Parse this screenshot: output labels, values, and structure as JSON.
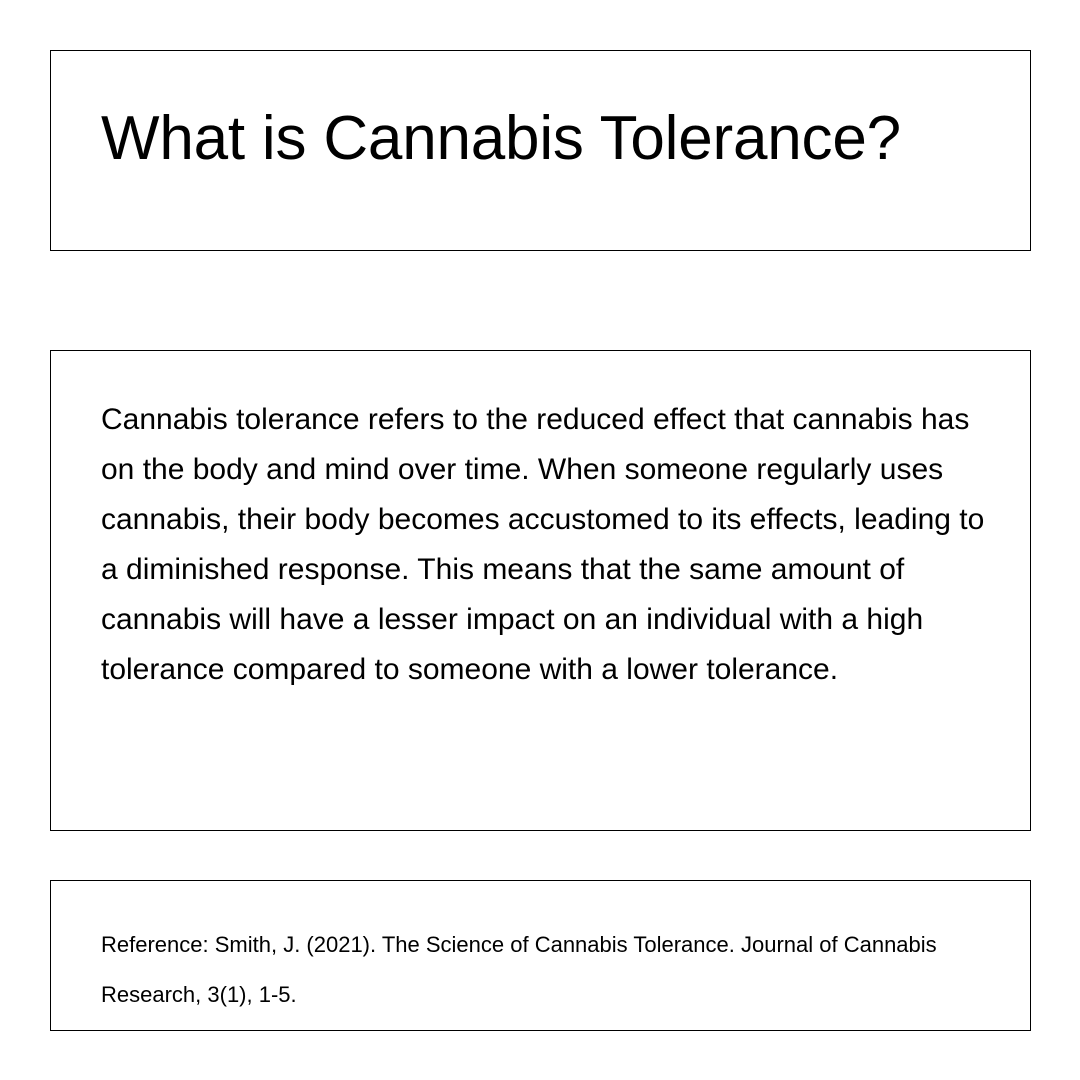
{
  "title": {
    "text": "What is Cannabis Tolerance?"
  },
  "body": {
    "text": "Cannabis tolerance refers to the reduced effect that cannabis has on the body and mind over time. When someone regularly uses cannabis, their body becomes accustomed to its effects, leading to a diminished response. This means that the same amount of cannabis will have a lesser impact on an individual with a high tolerance compared to someone with a lower tolerance."
  },
  "reference": {
    "text": "Reference: Smith, J. (2021). The Science of Cannabis Tolerance. Journal of Cannabis Research, 3(1), 1-5."
  },
  "colors": {
    "background": "#ffffff",
    "text": "#000000",
    "border": "#000000"
  }
}
